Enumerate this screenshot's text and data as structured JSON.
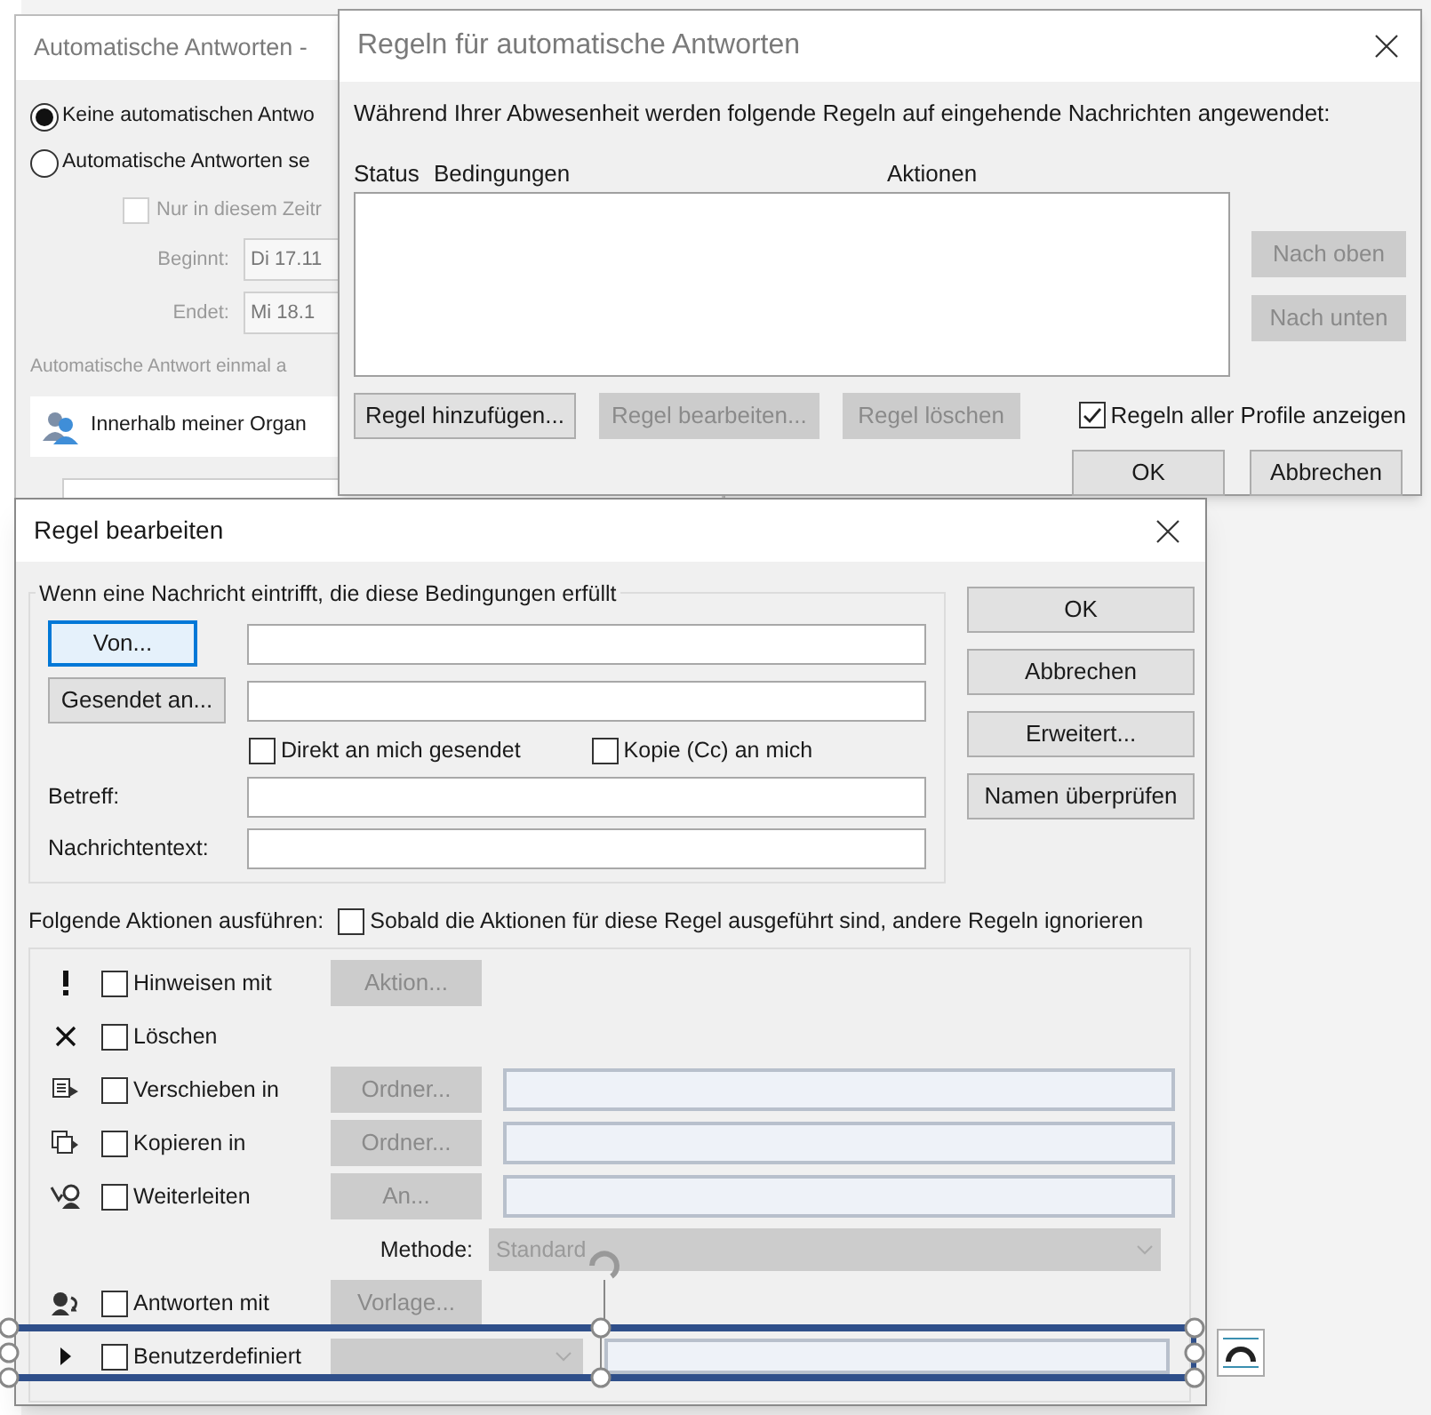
{
  "auto_reply_window": {
    "title": "Automatische Antworten -",
    "options": [
      {
        "label": "Keine automatischen Antwo",
        "selected": true
      },
      {
        "label": "Automatische Antworten se",
        "selected": false
      }
    ],
    "time_range": {
      "label": "Nur in diesem Zeitr",
      "checked": false
    },
    "start": {
      "label": "Beginnt:",
      "value": "Di 17.11"
    },
    "end": {
      "label": "Endet:",
      "value": "Mi 18.1"
    },
    "once_text": "Automatische Antwort einmal a",
    "tab": {
      "label": "Innerhalb meiner Organ"
    }
  },
  "rules_window": {
    "title": "Regeln für automatische Antworten",
    "intro": "Während Ihrer Abwesenheit werden folgende Regeln auf eingehende Nachrichten angewendet:",
    "columns": [
      "Status",
      "Bedingungen",
      "Aktionen"
    ],
    "side_buttons": [
      {
        "label": "Nach oben",
        "disabled": true
      },
      {
        "label": "Nach unten",
        "disabled": true
      }
    ],
    "rule_buttons": [
      {
        "label": "Regel hinzufügen...",
        "disabled": false
      },
      {
        "label": "Regel bearbeiten...",
        "disabled": true
      },
      {
        "label": "Regel löschen",
        "disabled": true
      }
    ],
    "show_all": {
      "label": "Regeln aller Profile anzeigen",
      "checked": true
    },
    "buttons": [
      {
        "label": "OK",
        "disabled": false
      },
      {
        "label": "Abbrechen",
        "disabled": false
      }
    ]
  },
  "edit_window": {
    "title": "Regel bearbeiten",
    "conditions_title": "Wenn eine Nachricht eintrifft, die diese Bedingungen erfüllt",
    "from_button": {
      "label": "Von...",
      "focused": true
    },
    "sent_to_button": {
      "label": "Gesendet an...",
      "focused": false
    },
    "checks": [
      {
        "label": "Direkt an mich gesendet",
        "checked": false
      },
      {
        "label": "Kopie (Cc) an mich",
        "checked": false
      }
    ],
    "subject_label": "Betreff:",
    "body_label": "Nachrichtentext:",
    "side_buttons": [
      "OK",
      "Abbrechen",
      "Erweitert...",
      "Namen überprüfen"
    ],
    "actions_label": "Folgende Aktionen ausführen:",
    "stop_rules": {
      "label": "Sobald die Aktionen für diese Regel ausgeführt sind, andere Regeln ignorieren",
      "checked": false
    },
    "actions": [
      {
        "kind": "button",
        "label": "Hinweisen mit",
        "checked": false,
        "button": "Aktion..."
      },
      {
        "kind": "plain",
        "label": "Löschen",
        "checked": false
      },
      {
        "kind": "field",
        "label": "Verschieben in",
        "checked": false,
        "button": "Ordner..."
      },
      {
        "kind": "field",
        "label": "Kopieren in",
        "checked": false,
        "button": "Ordner..."
      },
      {
        "kind": "field",
        "label": "Weiterleiten",
        "checked": false,
        "button": "An..."
      },
      {
        "kind": "method",
        "label": "Methode:",
        "value": "Standard"
      },
      {
        "kind": "button",
        "label": "Antworten mit",
        "checked": false,
        "button": "Vorlage..."
      },
      {
        "kind": "custom",
        "label": "Benutzerdefiniert",
        "checked": false
      }
    ]
  }
}
